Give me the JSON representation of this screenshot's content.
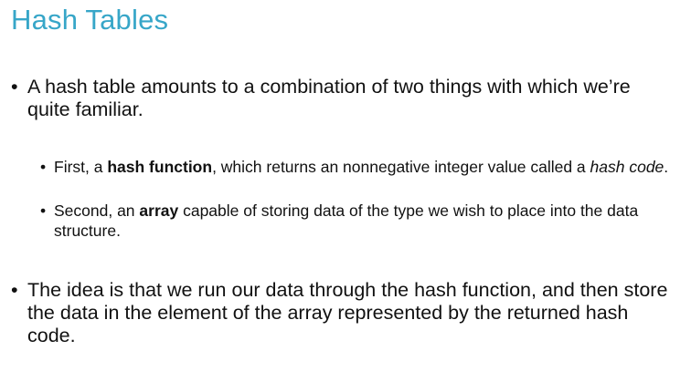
{
  "slide": {
    "title": "Hash Tables",
    "bullet_char": "•",
    "bullet1": {
      "text": "A hash table amounts to a combination of two things with which we’re quite familiar."
    },
    "sub1": {
      "part1": "First, a ",
      "bold": "hash function",
      "part2": ", which returns an nonnegative integer value called a ",
      "italic": "hash code",
      "part3": "."
    },
    "sub2": {
      "part1": "Second, an ",
      "bold": "array",
      "part2": " capable of storing data of the type we wish to place into the data structure."
    },
    "bullet2": {
      "text": "The idea is that we run our data through the hash function, and then store the data in the element of the array represented by the returned hash code."
    }
  },
  "colors": {
    "title": "#37a6c8",
    "text": "#111111",
    "background": "#ffffff"
  }
}
